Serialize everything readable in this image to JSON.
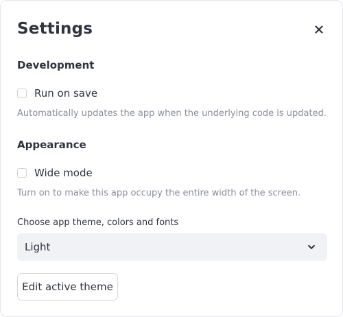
{
  "dialog": {
    "title": "Settings",
    "close_icon": "close-icon"
  },
  "development": {
    "heading": "Development",
    "run_on_save": {
      "label": "Run on save",
      "checked": false,
      "helper": "Automatically updates the app when the underlying code is updated."
    }
  },
  "appearance": {
    "heading": "Appearance",
    "wide_mode": {
      "label": "Wide mode",
      "checked": false,
      "helper": "Turn on to make this app occupy the entire width of the screen."
    },
    "theme": {
      "label": "Choose app theme, colors and fonts",
      "selected": "Light",
      "chevron_icon": "chevron-down-icon"
    },
    "edit_theme_label": "Edit active theme"
  },
  "colors": {
    "text": "#31333f",
    "helper_text": "#8a8d99",
    "select_background": "#f0f2f6",
    "border": "#d5d7de"
  }
}
